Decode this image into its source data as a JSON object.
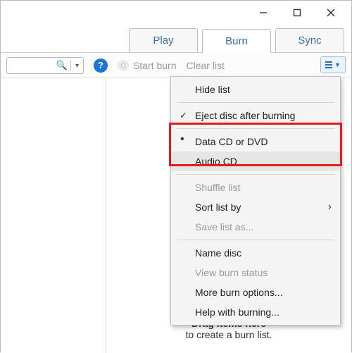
{
  "window_controls": {
    "minimize": "minimize",
    "maximize": "maximize",
    "close": "close"
  },
  "tabs": {
    "play": "Play",
    "burn": "Burn",
    "sync": "Sync"
  },
  "toolbar": {
    "start_burn": "Start burn",
    "clear_list": "Clear list"
  },
  "disc": {
    "badge": "CD"
  },
  "hint": {
    "line1": "Drag items here",
    "line2": "to create a burn list."
  },
  "menu": {
    "hide_list": "Hide list",
    "eject": "Eject disc after burning",
    "data_cd": "Data CD or DVD",
    "audio_cd": "Audio CD",
    "shuffle": "Shuffle list",
    "sort": "Sort list by",
    "save_as": "Save list as...",
    "name_disc": "Name disc",
    "view_status": "View burn status",
    "more_opts": "More burn options...",
    "help": "Help with burning..."
  }
}
